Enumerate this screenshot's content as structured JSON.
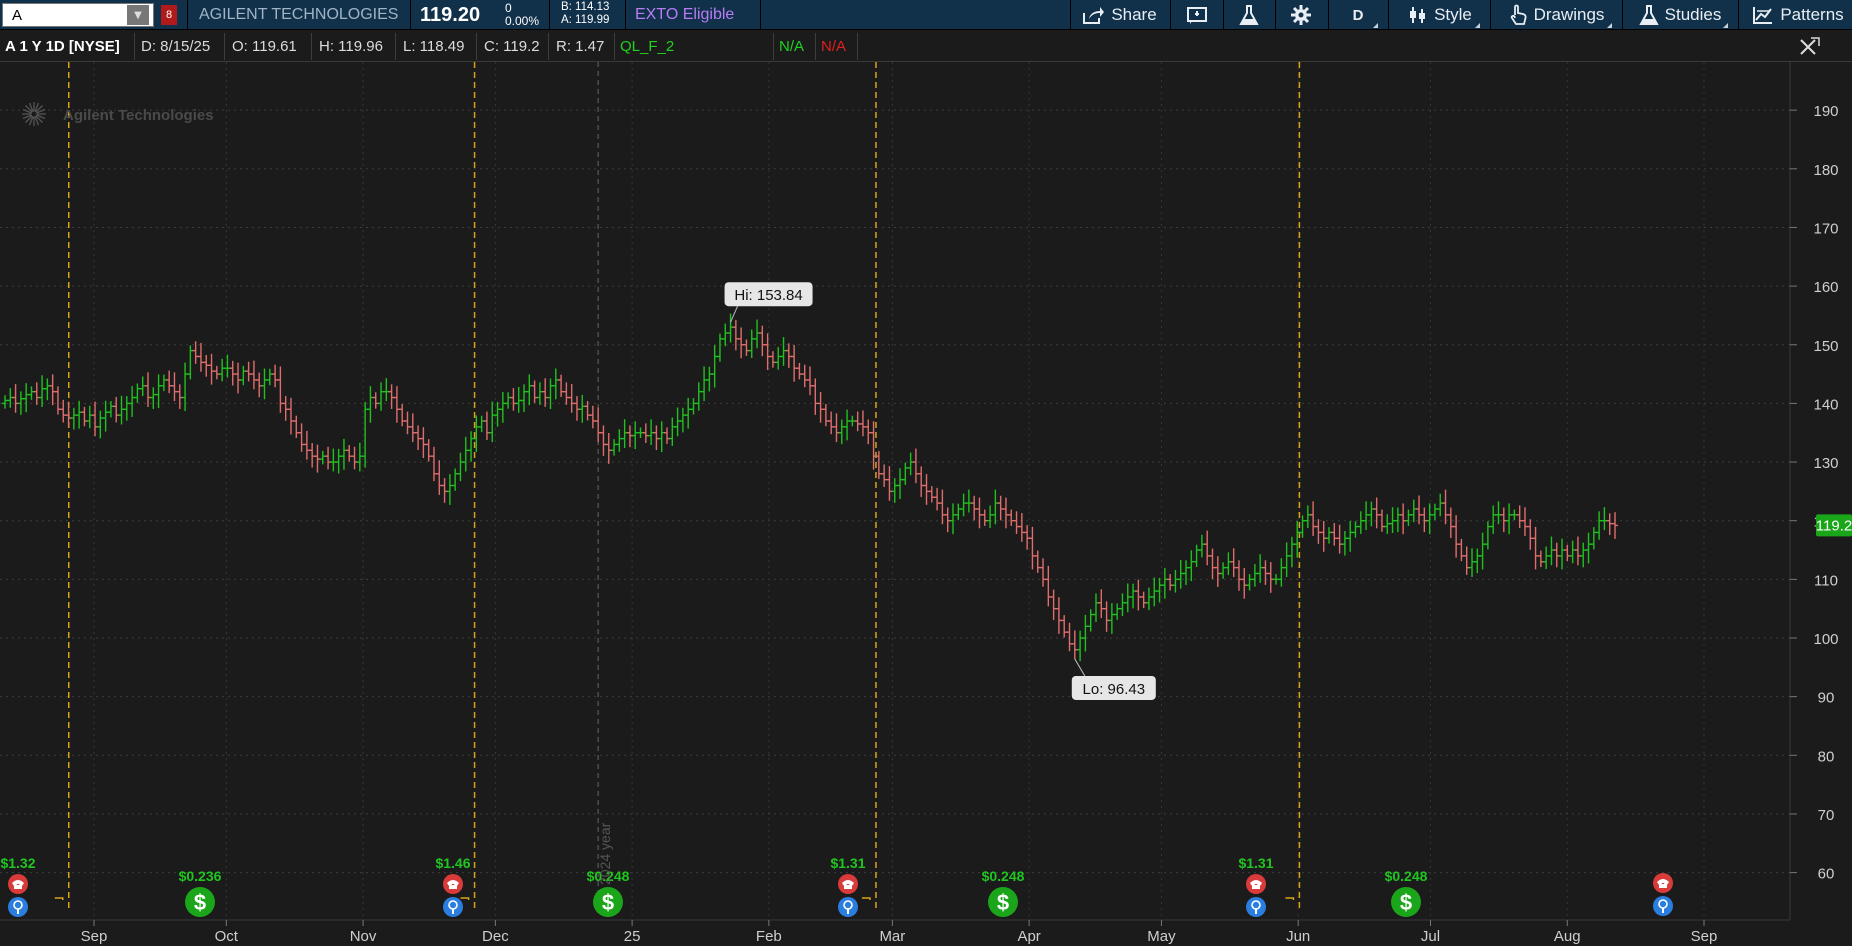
{
  "toolbar": {
    "symbol": "A",
    "link_badge": "8",
    "company": "AGILENT TECHNOLOGIES",
    "last_price": "119.20",
    "change": "0",
    "change_pct": "0.00%",
    "bid": "B: 114.13",
    "ask": "A: 119.99",
    "exto": "EXTO Eligible",
    "share_label": "Share",
    "aggregation": "D",
    "style_label": "Style",
    "drawings_label": "Drawings",
    "studies_label": "Studies",
    "patterns_label": "Patterns"
  },
  "infobar": {
    "symbol": "A 1 Y 1D [NYSE]",
    "date": "D: 8/15/25",
    "open": "O: 119.61",
    "high": "H: 119.96",
    "low": "L: 118.49",
    "close": "C: 119.2",
    "range": "R: 1.47",
    "study": "QL_F_2",
    "na_green": "N/A",
    "na_red": "N/A"
  },
  "chart_data": {
    "type": "ohlc",
    "watermark": "Agilent Technologies",
    "ylim": [
      52,
      198
    ],
    "yticks": [
      60,
      70,
      80,
      90,
      100,
      110,
      120,
      130,
      140,
      150,
      160,
      170,
      180,
      190
    ],
    "x_labels": [
      "Sep",
      "Oct",
      "Nov",
      "Dec",
      "25",
      "Feb",
      "Mar",
      "Apr",
      "May",
      "Jun",
      "Jul",
      "Aug",
      "Sep"
    ],
    "last_price_label": "119.2",
    "hi_label": "Hi: 153.84",
    "lo_label": "Lo: 96.43",
    "year_marker_label": "2024 year",
    "closes": [
      140.5,
      141,
      140,
      140.8,
      141.5,
      142,
      141,
      142.5,
      143,
      142,
      139,
      138,
      137.5,
      138,
      138.5,
      137,
      138,
      136,
      137.5,
      138.5,
      139.5,
      138,
      139,
      140,
      141,
      142.5,
      143,
      141,
      141.5,
      143,
      144,
      143,
      142,
      141,
      145,
      149,
      148,
      147,
      146.5,
      145.5,
      145,
      146,
      146,
      145,
      144,
      145.5,
      145,
      144,
      143,
      144,
      145,
      144,
      140,
      139,
      137,
      135,
      133,
      132,
      131,
      130.5,
      131,
      130,
      130,
      131,
      132,
      131,
      130,
      131,
      139,
      141,
      140,
      142,
      142,
      141,
      139,
      137,
      136,
      135,
      134,
      133,
      131,
      128,
      126,
      125,
      126,
      128,
      130,
      132,
      134,
      136,
      137,
      135,
      138,
      139,
      140,
      141,
      140,
      140.5,
      142,
      143,
      141,
      142,
      141,
      143,
      144,
      142,
      141,
      140,
      139,
      139.5,
      138,
      137,
      135,
      133,
      132,
      133,
      134,
      135,
      134.5,
      135,
      135,
      134.5,
      135,
      134,
      135,
      134,
      136,
      137,
      138,
      139,
      140,
      142,
      144,
      145,
      148,
      151,
      152,
      153,
      151,
      150,
      149,
      151,
      152,
      150,
      148,
      147,
      148,
      149,
      148,
      146,
      145,
      144,
      143,
      140,
      139,
      137,
      136,
      135,
      136,
      137,
      137,
      136.5,
      136,
      135,
      131,
      128,
      127,
      125,
      126,
      127,
      129,
      130,
      128,
      126,
      125,
      124,
      123,
      121,
      120,
      121,
      122,
      123,
      123,
      122,
      121,
      120,
      121,
      123,
      122,
      121,
      120,
      119,
      118,
      117,
      114,
      112,
      110,
      107,
      105,
      103,
      101,
      99,
      98,
      100,
      102,
      104,
      106,
      105,
      103,
      104,
      105,
      106,
      107,
      108,
      107,
      106,
      107,
      108,
      109,
      110,
      109,
      110,
      111,
      112,
      113,
      115,
      116,
      114,
      112,
      111,
      112,
      113,
      112,
      110,
      109,
      110,
      111,
      112,
      111,
      110,
      110,
      112,
      114,
      116,
      118,
      120,
      121,
      119,
      118,
      117,
      118,
      117,
      116,
      117,
      118,
      119,
      120,
      121,
      122,
      121,
      119,
      119.5,
      120,
      121,
      120,
      121,
      122,
      121,
      120,
      121,
      122,
      123,
      121,
      119,
      116,
      114,
      112,
      113,
      114,
      116,
      119,
      121,
      121,
      120,
      121,
      121,
      120,
      119,
      117,
      114,
      113,
      114,
      115,
      114,
      115,
      114,
      115,
      114,
      115,
      116,
      118,
      120,
      120,
      119.5,
      119.2
    ],
    "start_date": "2024-08-15",
    "end_date": "2025-08-15",
    "dividends": [
      {
        "label": "$1.32",
        "month": 0
      },
      {
        "label": "$1.46",
        "month": 3
      },
      {
        "label": "$1.31",
        "month": 6
      },
      {
        "label": "$1.31",
        "month": 9
      }
    ],
    "splits_labels": [
      "$0.236",
      "$0.248",
      "$0.248",
      "$0.248"
    ]
  }
}
